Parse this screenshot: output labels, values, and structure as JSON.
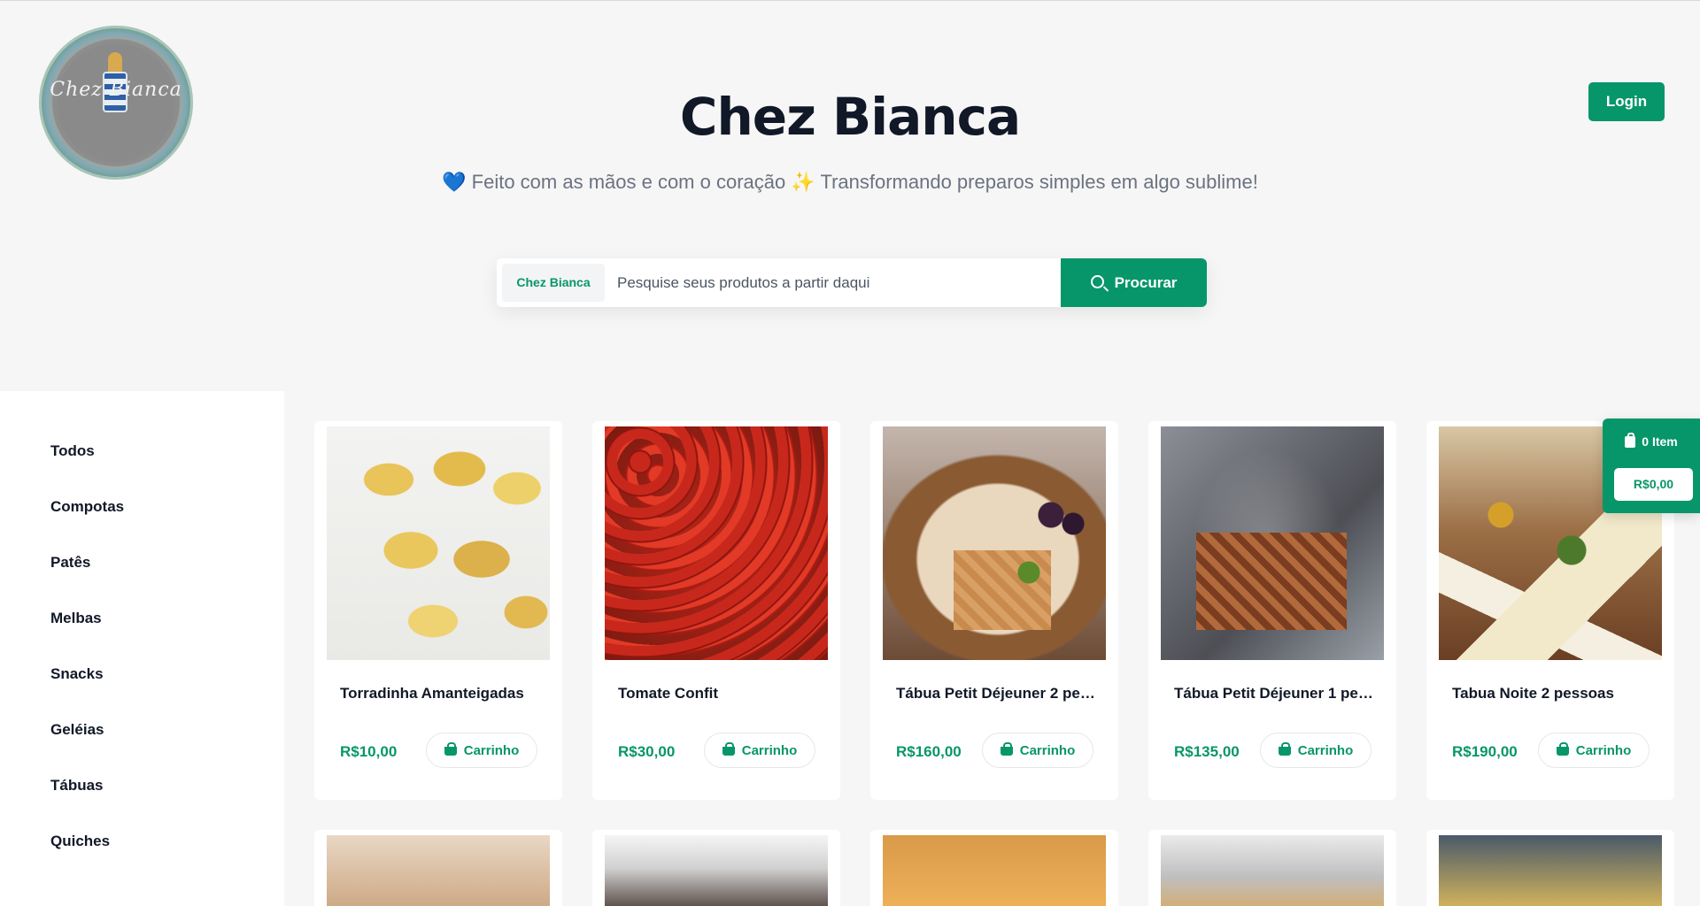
{
  "header": {
    "logo_text": "Chez Bianca",
    "title": "Chez Bianca",
    "subtitle": "💙 Feito com as mãos e com o coração ✨ Transformando preparos simples em algo sublime!",
    "login_label": "Login"
  },
  "search": {
    "tag": "Chez Bianca",
    "placeholder": "Pesquise seus produtos a partir daqui",
    "value": "",
    "button_label": "Procurar"
  },
  "sidebar": {
    "items": [
      {
        "label": "Todos"
      },
      {
        "label": "Compotas"
      },
      {
        "label": "Patês"
      },
      {
        "label": "Melbas"
      },
      {
        "label": "Snacks"
      },
      {
        "label": "Geléias"
      },
      {
        "label": "Tábuas"
      },
      {
        "label": "Quiches"
      }
    ]
  },
  "products": [
    {
      "name": "Torradinha Amanteigadas",
      "price": "R$10,00",
      "cart_label": "Carrinho"
    },
    {
      "name": "Tomate Confit",
      "price": "R$30,00",
      "cart_label": "Carrinho"
    },
    {
      "name": "Tábua Petit Déjeuner 2 pes...",
      "price": "R$160,00",
      "cart_label": "Carrinho"
    },
    {
      "name": "Tábua Petit Déjeuner 1 pes...",
      "price": "R$135,00",
      "cart_label": "Carrinho"
    },
    {
      "name": "Tabua Noite 2 pessoas",
      "price": "R$190,00",
      "cart_label": "Carrinho"
    }
  ],
  "floating_cart": {
    "items_label": "0 Item",
    "total": "R$0,00"
  },
  "colors": {
    "accent": "#079669",
    "background": "#f6f6f6",
    "title": "#111827"
  },
  "icons": [
    "logo",
    "search-icon",
    "basket-icon",
    "shopping-bag-icon"
  ]
}
